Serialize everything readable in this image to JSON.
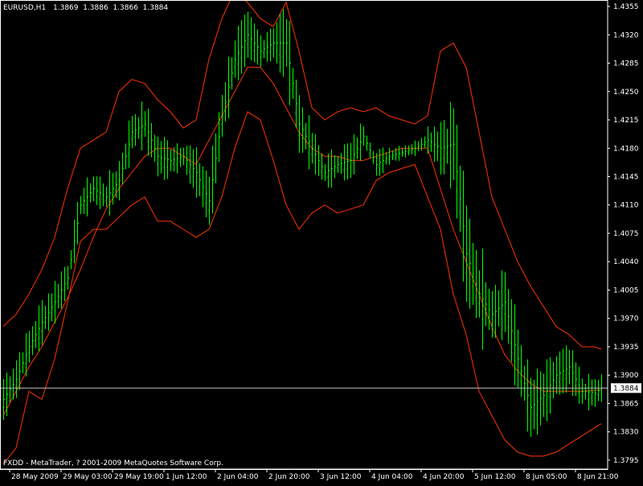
{
  "header": {
    "symbol_timeframe": "EURUSD,H1",
    "ohlc": "1.3869  1.3886  1.3866  1.3884"
  },
  "footer": {
    "copyright": "FXDD - MetaTrader, ? 2001-2009 MetaQuotes Software Corp."
  },
  "colors": {
    "background": "#000000",
    "axis": "#ffffff",
    "candle": "#00ff00",
    "band": "#ff3300",
    "price_line": "#c0c0c0"
  },
  "chart_data": {
    "type": "line",
    "title": "EURUSD,H1",
    "ylim": [
      1.3784,
      1.4362
    ],
    "y_ticks": [
      "1.4355",
      "1.4320",
      "1.4285",
      "1.4250",
      "1.4215",
      "1.4180",
      "1.4145",
      "1.4110",
      "1.4075",
      "1.4040",
      "1.4005",
      "1.3970",
      "1.3935",
      "1.3900",
      "1.3865",
      "1.3830",
      "1.3795"
    ],
    "x_ticks": [
      "28 May 2009",
      "29 May 03:00",
      "29 May 19:00",
      "1 Jun 12:00",
      "2 Jun 04:00",
      "2 Jun 20:00",
      "3 Jun 12:00",
      "4 Jun 04:00",
      "4 Jun 20:00",
      "5 Jun 12:00",
      "8 Jun 05:00",
      "8 Jun 21:00"
    ],
    "x_tick_bars": [
      2,
      18,
      34,
      50,
      66,
      82,
      98,
      114,
      130,
      146,
      162,
      178
    ],
    "current_price": "1.3884",
    "price_series": {
      "name": "EURUSD close",
      "bars": [
        0,
        4,
        8,
        12,
        16,
        20,
        24,
        28,
        32,
        36,
        40,
        44,
        48,
        52,
        56,
        60,
        64,
        68,
        72,
        76,
        80,
        84,
        88,
        92,
        96,
        100,
        104,
        108,
        112,
        116,
        120,
        124,
        128,
        132,
        136,
        140,
        144,
        148,
        152,
        156,
        160,
        164,
        168,
        172,
        176,
        180,
        184,
        186
      ],
      "values": [
        1.387,
        1.3895,
        1.3935,
        1.3965,
        1.399,
        1.402,
        1.411,
        1.413,
        1.412,
        1.414,
        1.42,
        1.421,
        1.417,
        1.4165,
        1.417,
        1.415,
        1.4115,
        1.422,
        1.429,
        1.432,
        1.43,
        1.431,
        1.431,
        1.421,
        1.418,
        1.415,
        1.416,
        1.4165,
        1.4195,
        1.416,
        1.417,
        1.4175,
        1.418,
        1.419,
        1.418,
        1.4185,
        1.405,
        1.4,
        1.3975,
        1.399,
        1.392,
        1.386,
        1.3875,
        1.39,
        1.391,
        1.388,
        1.3878,
        1.3884
      ]
    },
    "series": [
      {
        "name": "Upper band",
        "bars": [
          0,
          4,
          8,
          12,
          16,
          20,
          24,
          28,
          32,
          36,
          40,
          44,
          48,
          52,
          56,
          60,
          64,
          68,
          72,
          76,
          80,
          84,
          88,
          92,
          96,
          100,
          104,
          108,
          112,
          116,
          120,
          124,
          128,
          132,
          136,
          140,
          144,
          148,
          152,
          156,
          160,
          164,
          168,
          172,
          176,
          180,
          184,
          186
        ],
        "values": [
          1.396,
          1.3975,
          1.4,
          1.403,
          1.407,
          1.413,
          1.418,
          1.419,
          1.42,
          1.425,
          1.4265,
          1.426,
          1.424,
          1.4225,
          1.4205,
          1.4215,
          1.429,
          1.434,
          1.4375,
          1.436,
          1.434,
          1.433,
          1.436,
          1.43,
          1.423,
          1.4215,
          1.4225,
          1.423,
          1.4225,
          1.423,
          1.422,
          1.4215,
          1.421,
          1.422,
          1.43,
          1.431,
          1.428,
          1.42,
          1.412,
          1.408,
          1.404,
          1.401,
          1.3985,
          1.396,
          1.395,
          1.3935,
          1.3935,
          1.3932
        ]
      },
      {
        "name": "Middle band",
        "bars": [
          0,
          4,
          8,
          12,
          16,
          20,
          24,
          28,
          32,
          36,
          40,
          44,
          48,
          52,
          56,
          60,
          64,
          68,
          72,
          76,
          80,
          84,
          88,
          92,
          96,
          100,
          104,
          108,
          112,
          116,
          120,
          124,
          128,
          132,
          136,
          140,
          144,
          148,
          152,
          156,
          160,
          164,
          168,
          172,
          176,
          180,
          184,
          186
        ],
        "values": [
          1.385,
          1.388,
          1.391,
          1.3935,
          1.3965,
          1.3995,
          1.403,
          1.407,
          1.4105,
          1.413,
          1.415,
          1.417,
          1.418,
          1.418,
          1.417,
          1.416,
          1.419,
          1.422,
          1.425,
          1.428,
          1.428,
          1.426,
          1.423,
          1.42,
          1.418,
          1.417,
          1.417,
          1.4165,
          1.4165,
          1.417,
          1.4175,
          1.418,
          1.418,
          1.418,
          1.413,
          1.408,
          1.404,
          1.4,
          1.396,
          1.3925,
          1.3905,
          1.389,
          1.388,
          1.388,
          1.388,
          1.388,
          1.3881,
          1.3882
        ]
      },
      {
        "name": "Lower band",
        "bars": [
          0,
          4,
          8,
          12,
          16,
          20,
          24,
          28,
          32,
          36,
          40,
          44,
          48,
          52,
          56,
          60,
          64,
          68,
          72,
          76,
          80,
          84,
          88,
          92,
          96,
          100,
          104,
          108,
          112,
          116,
          120,
          124,
          128,
          132,
          136,
          140,
          144,
          148,
          152,
          156,
          160,
          164,
          168,
          172,
          176,
          180,
          184,
          186
        ],
        "values": [
          1.379,
          1.381,
          1.388,
          1.387,
          1.392,
          1.399,
          1.4065,
          1.408,
          1.408,
          1.4095,
          1.411,
          1.412,
          1.409,
          1.409,
          1.408,
          1.407,
          1.408,
          1.412,
          1.418,
          1.4225,
          1.4215,
          1.4165,
          1.411,
          1.408,
          1.41,
          1.411,
          1.41,
          1.4105,
          1.411,
          1.414,
          1.415,
          1.4155,
          1.416,
          1.412,
          1.408,
          1.4,
          1.395,
          1.388,
          1.385,
          1.382,
          1.3805,
          1.38,
          1.38,
          1.3805,
          1.3815,
          1.3825,
          1.3835,
          1.384
        ]
      }
    ]
  }
}
